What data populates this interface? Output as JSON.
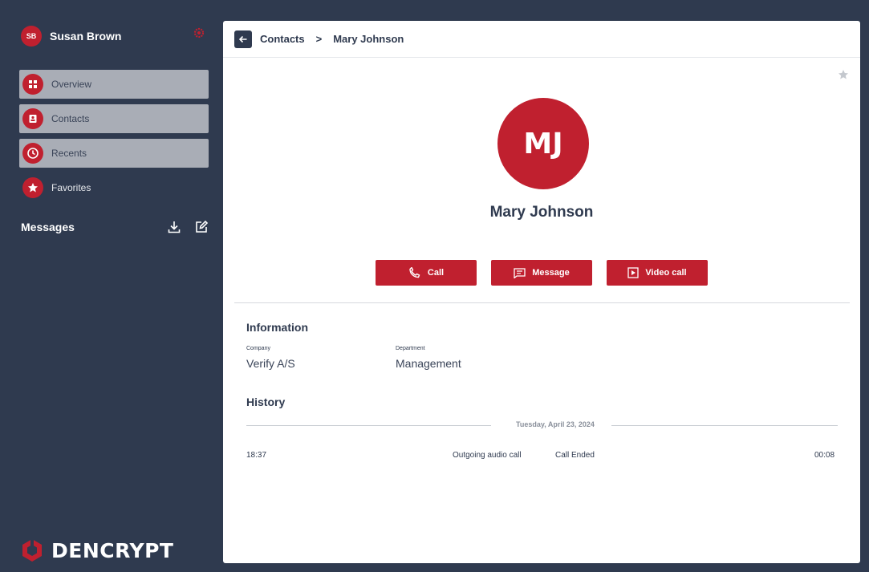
{
  "user": {
    "initials": "SB",
    "name": "Susan Brown"
  },
  "nav": [
    {
      "label": "Overview",
      "icon": "grid-icon"
    },
    {
      "label": "Contacts",
      "icon": "contacts-icon"
    },
    {
      "label": "Recents",
      "icon": "clock-icon"
    },
    {
      "label": "Favorites",
      "icon": "star-icon"
    }
  ],
  "messages": {
    "title": "Messages"
  },
  "brand": {
    "name": "DENCRYPT"
  },
  "breadcrumb": {
    "parent": "Contacts",
    "separator": ">",
    "current": "Mary Johnson"
  },
  "contact": {
    "initials": "MJ",
    "name": "Mary Johnson",
    "actions": {
      "call": "Call",
      "message": "Message",
      "video": "Video call"
    }
  },
  "information": {
    "title": "Information",
    "company_label": "Company",
    "company_value": "Verify A/S",
    "department_label": "Department",
    "department_value": "Management"
  },
  "history": {
    "title": "History",
    "date": "Tuesday, April 23, 2024",
    "entries": [
      {
        "time": "18:37",
        "type": "Outgoing audio call",
        "status": "Call Ended",
        "duration": "00:08"
      }
    ]
  },
  "colors": {
    "accent": "#c0202f",
    "sidebar": "#2f3a4f",
    "nav_item_bg": "#a9adb6"
  }
}
